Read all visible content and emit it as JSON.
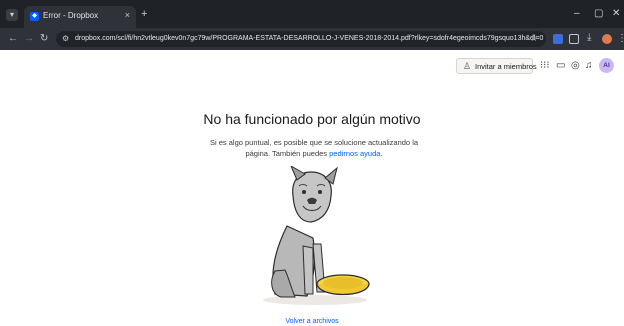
{
  "browser": {
    "tab_title": "Error - Dropbox",
    "tab_close": "×",
    "new_tab": "+",
    "url": "dropbox.com/scl/fi/hn2vtleug0kev0n7gc79w/PROGRAMA-ESTATA-DESARROLLO-J-VENES-2018-2014.pdf?rlkey=sdofr4egeoimcds79gsquo13h&dl=0",
    "minimize": "–",
    "maximize": "▢",
    "close": "✕"
  },
  "header": {
    "invite_label": "Invitar a miembros",
    "avatar_initials": "AI"
  },
  "content": {
    "heading": "No ha funcionado por algún motivo",
    "description": "Si es algo puntual, es posible que se solucione actualizando la página. También puedes ",
    "help_link": "pedirnos ayuda",
    "help_suffix": ".",
    "back_link": "Volver a archivos"
  },
  "colors": {
    "accent": "#0061fe",
    "chrome_dark": "#1f2227",
    "bowl": "#f5d547",
    "dog": "#b8b8b8"
  },
  "icons": [
    "menu-icon",
    "dropbox-icon",
    "back-icon",
    "forward-icon",
    "reload-icon",
    "site-info-icon",
    "star-icon",
    "invite-person-icon",
    "app-grid-icon",
    "comment-icon",
    "activity-icon",
    "bell-icon"
  ]
}
